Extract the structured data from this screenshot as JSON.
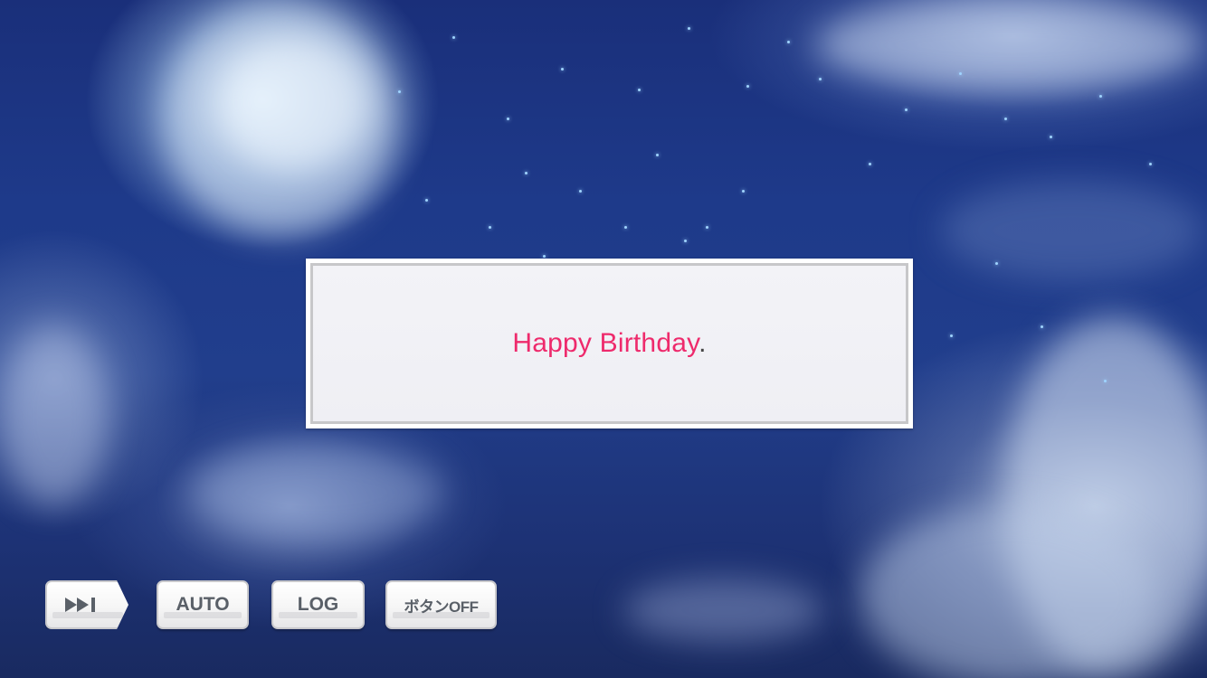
{
  "dialog": {
    "text": "Happy Birthday",
    "period": "."
  },
  "controls": {
    "skip_icon": "fast-forward-skip-icon",
    "auto_label": "AUTO",
    "log_label": "LOG",
    "buttons_off_label": "ボタンOFF"
  },
  "colors": {
    "dialog_text": "#ee2a6c",
    "button_text": "#5a6068"
  }
}
